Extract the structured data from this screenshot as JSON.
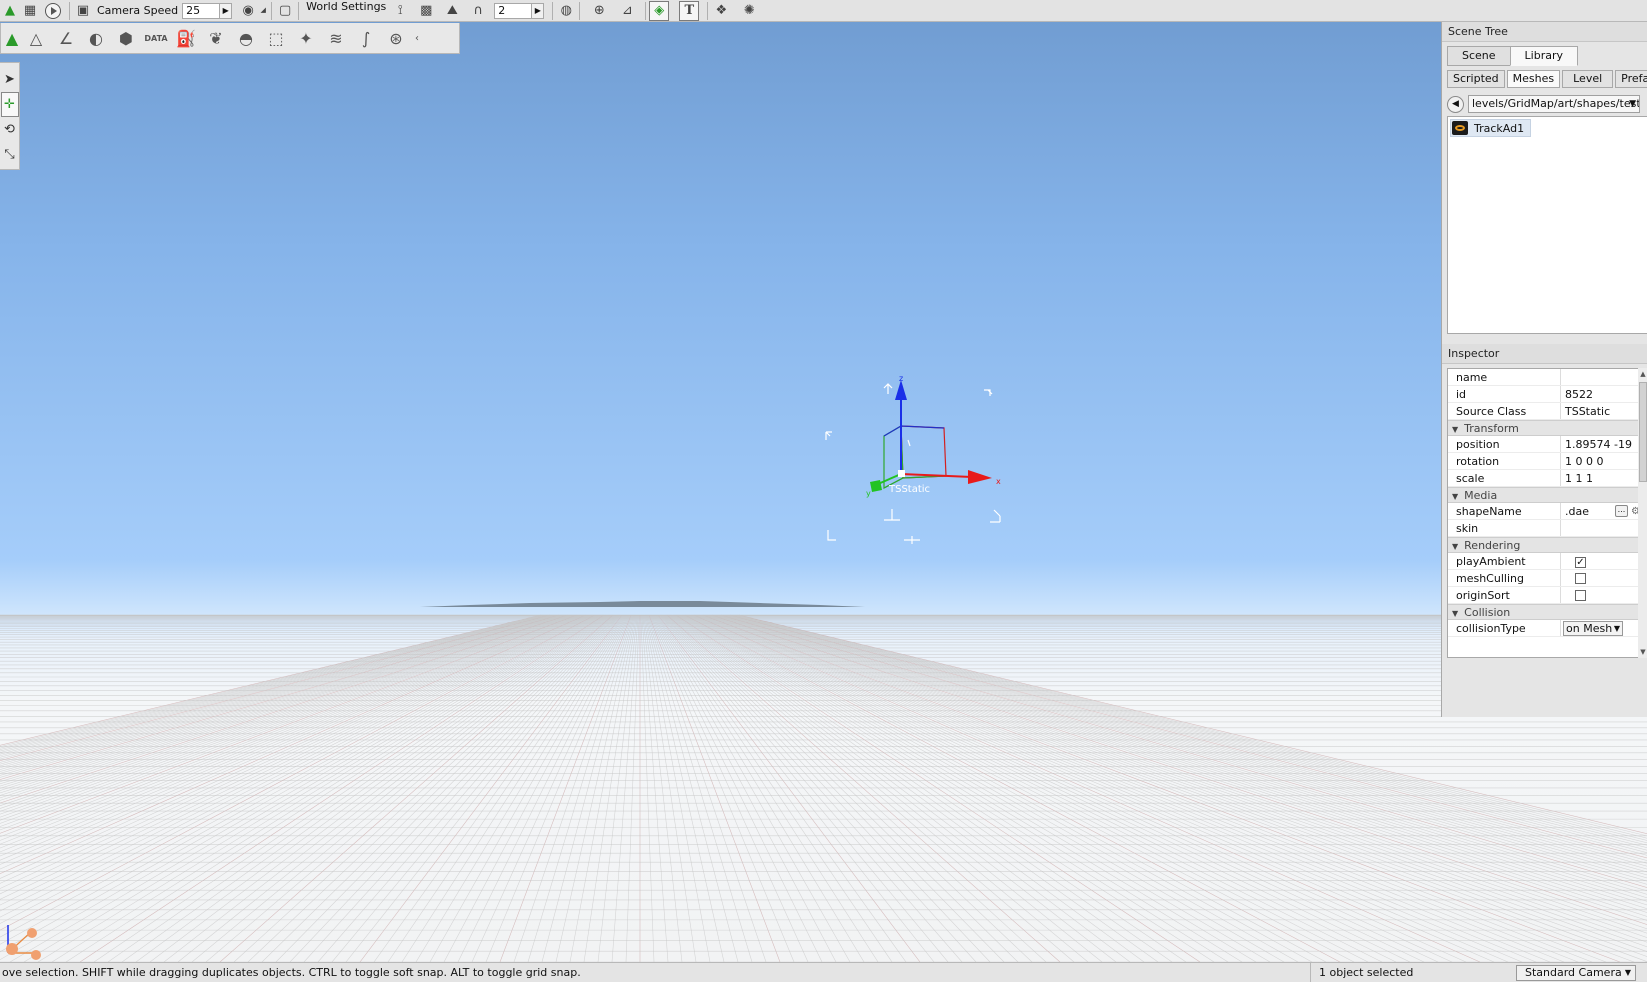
{
  "toolbar": {
    "camera_speed_label": "Camera Speed",
    "camera_speed_value": "25",
    "world_settings_label": "World Settings",
    "snap_value": "2"
  },
  "scene_tree": {
    "title": "Scene Tree",
    "tabs": [
      {
        "label": "Scene",
        "active": false
      },
      {
        "label": "Library",
        "active": true
      }
    ],
    "library_tabs": [
      {
        "label": "Scripted",
        "active": false
      },
      {
        "label": "Meshes",
        "active": true
      },
      {
        "label": "Level",
        "active": false
      },
      {
        "label": "Prefabs",
        "active": false
      }
    ],
    "path": "levels/GridMap/art/shapes/test",
    "items": [
      {
        "label": "TrackAd1",
        "icon": "mesh-icon"
      }
    ]
  },
  "inspector": {
    "title": "Inspector",
    "fields": {
      "name": {
        "label": "name",
        "value": ""
      },
      "id": {
        "label": "id",
        "value": "8522"
      },
      "source_class": {
        "label": "Source Class",
        "value": "TSStatic"
      }
    },
    "groups": {
      "transform": "Transform",
      "media": "Media",
      "rendering": "Rendering",
      "collision": "Collision"
    },
    "transform": {
      "position": {
        "label": "position",
        "value": "1.89574 -19"
      },
      "rotation": {
        "label": "rotation",
        "value": "1 0 0 0"
      },
      "scale": {
        "label": "scale",
        "value": "1 1 1"
      }
    },
    "media": {
      "shape_name": {
        "label": "shapeName",
        "value": ".dae",
        "button": "..."
      },
      "skin": {
        "label": "skin",
        "value": ""
      }
    },
    "rendering": {
      "play_ambient": {
        "label": "playAmbient",
        "checked": true
      },
      "mesh_culling": {
        "label": "meshCulling",
        "checked": false
      },
      "origin_sort": {
        "label": "originSort",
        "checked": false
      }
    },
    "collision": {
      "collision_type": {
        "label": "collisionType",
        "value": "on Mesh"
      }
    }
  },
  "viewport": {
    "object_label": "TSStatic",
    "axis_labels": {
      "x": "x",
      "y": "y",
      "z": "z"
    }
  },
  "status": {
    "message": "ove selection.  SHIFT while dragging duplicates objects.  CTRL to toggle soft snap.  ALT to toggle grid snap.",
    "selection": "1 object selected",
    "camera": "Standard Camera"
  },
  "colors": {
    "axis_x": "#e81a1a",
    "axis_y": "#22c322",
    "axis_z": "#1a2fe8",
    "panel_bg": "#e5e5e5"
  }
}
